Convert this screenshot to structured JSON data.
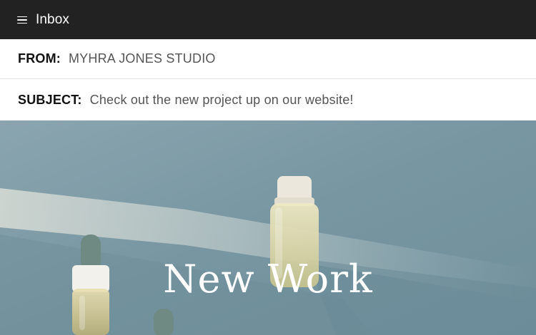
{
  "header": {
    "menu_icon": "menu-icon",
    "title": "Inbox"
  },
  "email": {
    "from_label": "FROM:",
    "from_value": "MYHRA JONES STUDIO",
    "subject_label": "SUBJECT:",
    "subject_value": "Check out the new project up on our website!"
  },
  "hero": {
    "title": "New Work"
  },
  "colors": {
    "topbar": "#222222",
    "hero_background": "#7d9aa5"
  }
}
